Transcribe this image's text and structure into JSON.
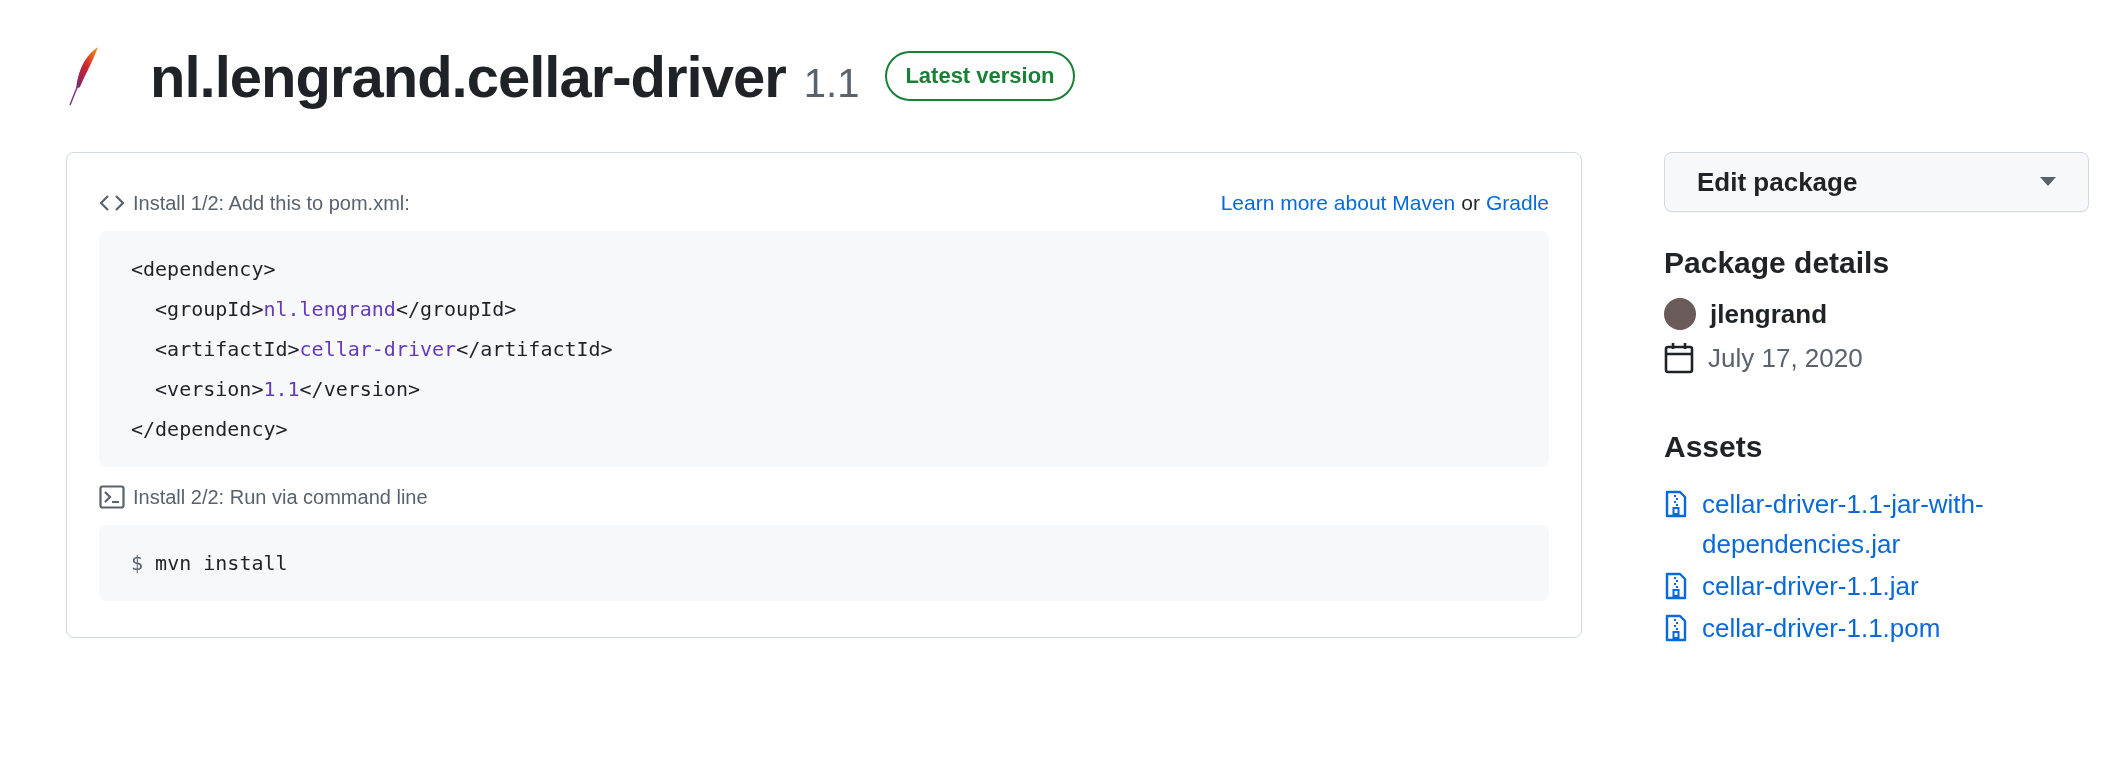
{
  "header": {
    "title": "nl.lengrand.cellar-driver",
    "version": "1.1",
    "badge": "Latest version"
  },
  "install_steps": [
    {
      "kind": "xml",
      "label": "Install 1/2: Add this to pom.xml:",
      "help": [
        {
          "kind": "link",
          "text": "Learn more about Maven"
        },
        {
          "kind": "text",
          "text": "or"
        },
        {
          "kind": "link",
          "text": "Gradle"
        }
      ],
      "code_lines": [
        [
          {
            "kind": "tag",
            "text": "<dependency>"
          }
        ],
        [
          {
            "kind": "tag",
            "text": "  <groupId>"
          },
          {
            "kind": "value",
            "text": "nl.lengrand"
          },
          {
            "kind": "tag",
            "text": "</groupId>"
          }
        ],
        [
          {
            "kind": "tag",
            "text": "  <artifactId>"
          },
          {
            "kind": "value",
            "text": "cellar-driver"
          },
          {
            "kind": "tag",
            "text": "</artifactId>"
          }
        ],
        [
          {
            "kind": "tag",
            "text": "  <version>"
          },
          {
            "kind": "value",
            "text": "1.1"
          },
          {
            "kind": "tag",
            "text": "</version>"
          }
        ],
        [
          {
            "kind": "tag",
            "text": "</dependency>"
          }
        ]
      ]
    },
    {
      "kind": "shell",
      "label": "Install 2/2: Run via command line",
      "code_lines": [
        [
          {
            "kind": "prompt",
            "text": "$"
          },
          {
            "kind": "tag",
            "text": " mvn install"
          }
        ]
      ]
    }
  ],
  "sidebar": {
    "edit_button": "Edit package",
    "details_title": "Package details",
    "author": "jlengrand",
    "date": "July 17, 2020",
    "assets_title": "Assets",
    "assets": [
      {
        "name": "cellar-driver-1.1-jar-with-dependencies.jar"
      },
      {
        "name": "cellar-driver-1.1.jar"
      },
      {
        "name": "cellar-driver-1.1.pom"
      }
    ]
  }
}
